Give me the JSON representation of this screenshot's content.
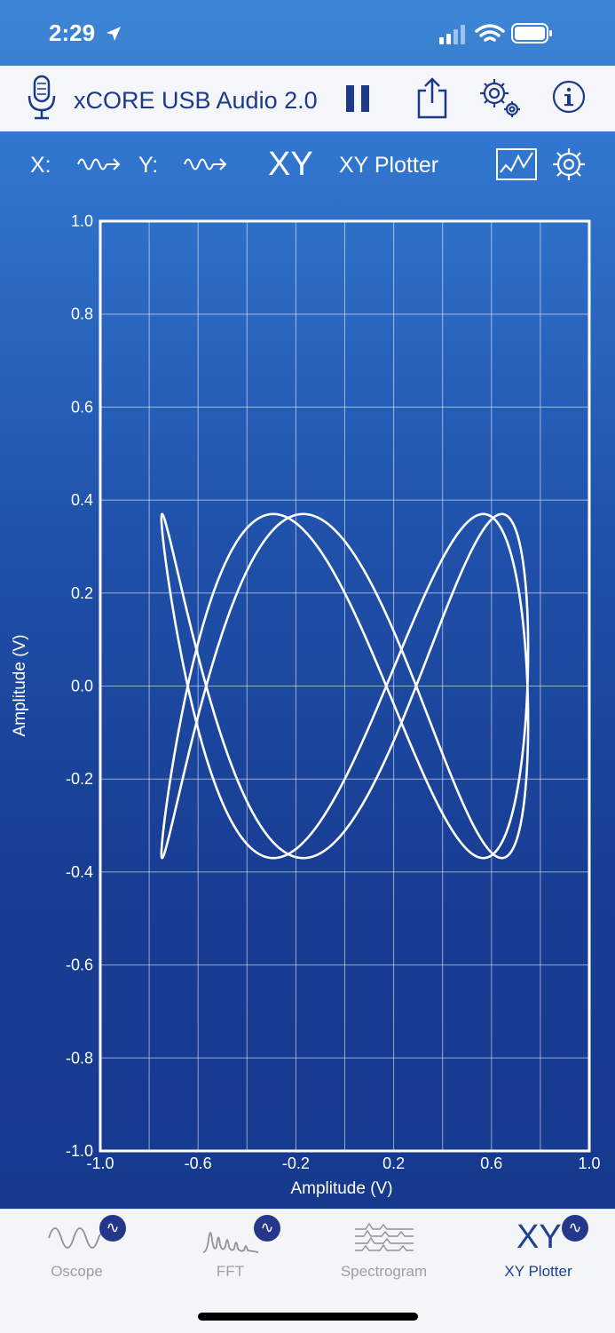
{
  "status_bar": {
    "time": "2:29"
  },
  "toolbar": {
    "device_name": "xCORE USB Audio 2.0"
  },
  "mode_bar": {
    "x_label": "X:",
    "y_label": "Y:",
    "mode_badge": "XY",
    "mode_title": "XY Plotter"
  },
  "chart_data": {
    "type": "line",
    "xlabel": "Amplitude (V)",
    "ylabel": "Amplitude (V)",
    "xlim": [
      -1.0,
      1.0
    ],
    "ylim": [
      -1.0,
      1.0
    ],
    "x_ticks": [
      "-1.0",
      "-0.6",
      "-0.2",
      "0.2",
      "0.6",
      "1.0"
    ],
    "y_ticks": [
      "1.0",
      "0.8",
      "0.6",
      "0.4",
      "0.2",
      "0.0",
      "-0.2",
      "-0.4",
      "-0.6",
      "-0.8",
      "-1.0"
    ],
    "grid": true,
    "series": [
      {
        "x_amplitude": 0.75,
        "y_amplitude": 0.37,
        "x_frequency": 2,
        "y_frequency": 5,
        "phase": 0.4
      }
    ]
  },
  "tabs": [
    {
      "label": "Oscope",
      "badge": "∿"
    },
    {
      "label": "FFT",
      "badge": "∿"
    },
    {
      "label": "Spectrogram"
    },
    {
      "label": "XY Plotter",
      "icon_text": "XY",
      "badge": "∿"
    }
  ],
  "colors": {
    "accent": "#1e3f92",
    "plot_bg": "#1b4399",
    "status_bg": "#3a7fd0"
  }
}
